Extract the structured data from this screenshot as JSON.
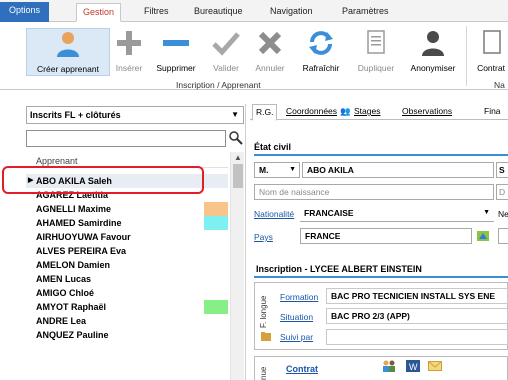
{
  "ribbon_tabs": {
    "options": "Options",
    "gestion": "Gestion",
    "filtres": "Filtres",
    "bureautique": "Bureautique",
    "navigation": "Navigation",
    "parametres": "Paramètres"
  },
  "ribbon": {
    "creer": "Créer apprenant",
    "inserer": "Insérer",
    "supprimer": "Supprimer",
    "valider": "Valider",
    "annuler": "Annuler",
    "rafraichir": "Rafraîchir",
    "dupliquer": "Dupliquer",
    "anonymiser": "Anonymiser",
    "contrat": "Contrat",
    "group_inscription": "Inscription / Apprenant",
    "group_na": "Na"
  },
  "left": {
    "filter_value": "Inscrits FL + clôturés",
    "search_value": "",
    "column_header": "Apprenant",
    "rows": [
      {
        "name": "ABO AKILA Saleh",
        "swatch": ""
      },
      {
        "name": "AGAREZ Laetitia",
        "swatch": ""
      },
      {
        "name": "AGNELLI Maxime",
        "swatch": "#f9c48a"
      },
      {
        "name": "AHAMED Samirdine",
        "swatch": "#7ff0f2"
      },
      {
        "name": "AIRHUOYUWA Favour",
        "swatch": ""
      },
      {
        "name": "ALVES PEREIRA Eva",
        "swatch": ""
      },
      {
        "name": "AMELON Damien",
        "swatch": ""
      },
      {
        "name": "AMEN Lucas",
        "swatch": ""
      },
      {
        "name": "AMIGO Chloé",
        "swatch": ""
      },
      {
        "name": "AMYOT Raphaël",
        "swatch": "#86ef86"
      },
      {
        "name": "ANDRE Lea",
        "swatch": ""
      },
      {
        "name": "ANQUEZ Pauline",
        "swatch": ""
      }
    ]
  },
  "right": {
    "subtabs": {
      "rg": "R.G.",
      "coordonnees": "Coordonnées",
      "stages": "Stages",
      "observations": "Observations",
      "fina": "Fina"
    },
    "etat_civil": "État civil",
    "civilite": "M.",
    "nom": "ABO AKILA",
    "nom_naissance_placeholder": "Nom de naissance",
    "nationalite_label": "Nationalité",
    "nationalite": "FRANCAISE",
    "pays_label": "Pays",
    "pays": "FRANCE",
    "inscription_title": "Inscription - LYCEE ALBERT EINSTEIN",
    "f_longue": "F. longue",
    "formation_label": "Formation",
    "formation": "BAC PRO TECNICIEN INSTALL SYS ENE",
    "situation_label": "Situation",
    "situation": "BAC PRO 2/3 (APP)",
    "suivi_label": "Suivi par",
    "contrat_label": "Contrat",
    "cut_s": "S",
    "cut_d": "D",
    "cut_ne": "Ne",
    "cut_nue": "nue"
  }
}
